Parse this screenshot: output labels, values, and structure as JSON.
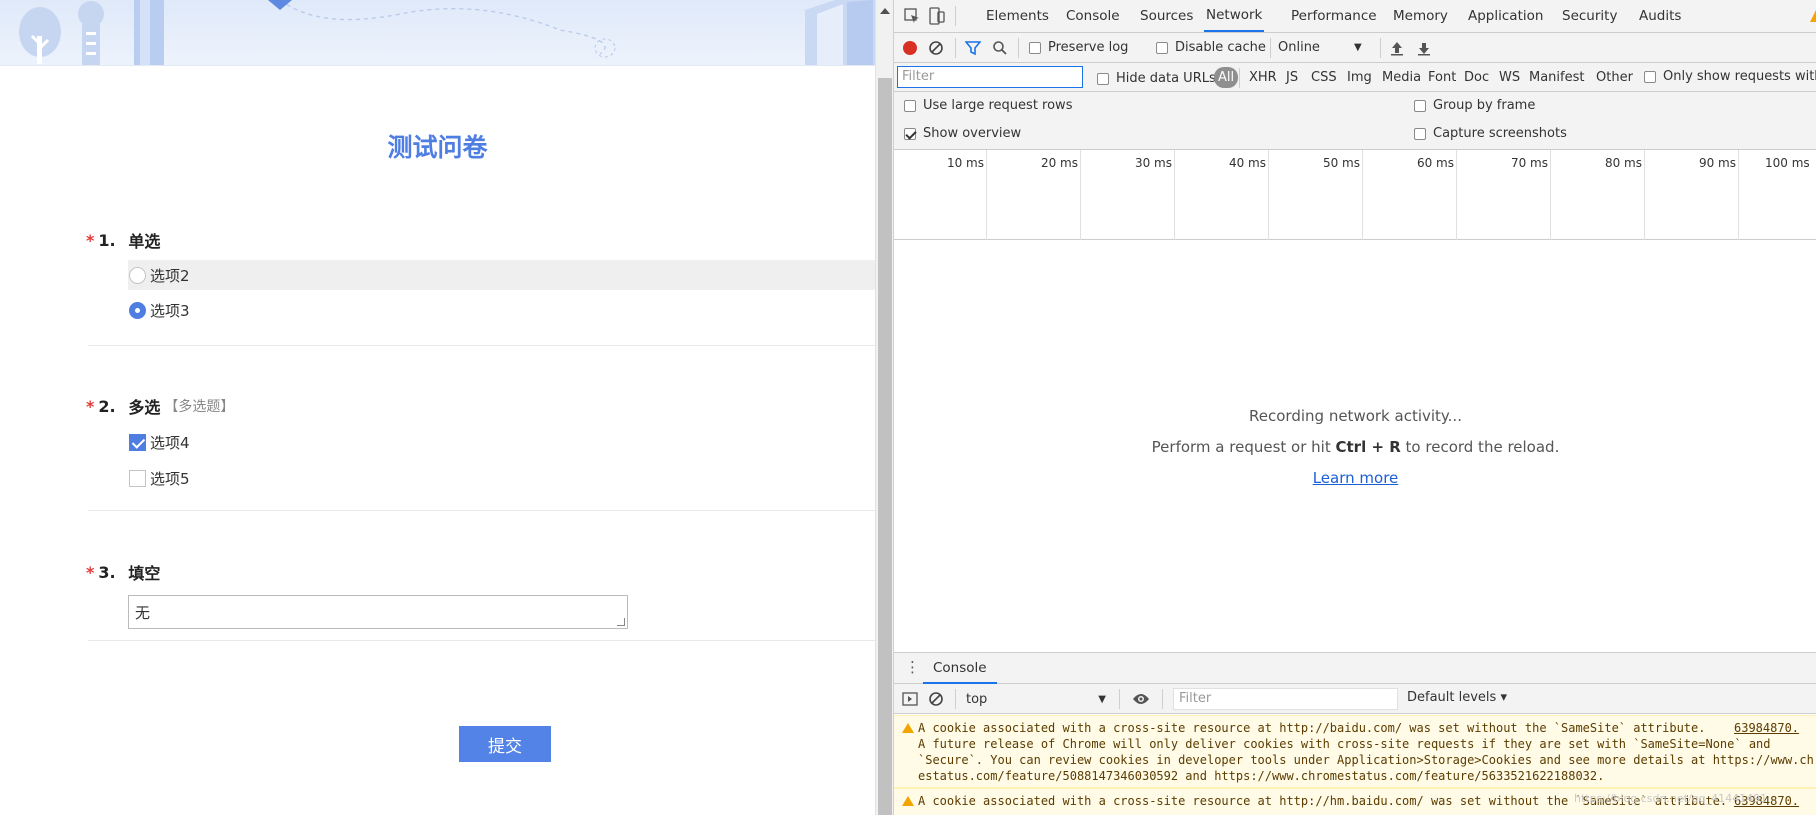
{
  "survey": {
    "title": "测试问卷",
    "questions": [
      {
        "star": "*",
        "number": "1.",
        "label": "单选",
        "options": [
          {
            "label": "选项2",
            "selected": false
          },
          {
            "label": "选项3",
            "selected": true
          }
        ]
      },
      {
        "star": "*",
        "number": "2.",
        "label": "多选",
        "type_tag": "【多选题】",
        "options": [
          {
            "label": "选项4",
            "checked": true
          },
          {
            "label": "选项5",
            "checked": false
          }
        ]
      },
      {
        "star": "*",
        "number": "3.",
        "label": "填空",
        "value": "无"
      }
    ],
    "submit_label": "提交",
    "accent_color": "#4f7ee3"
  },
  "devtools": {
    "tabs": [
      "Elements",
      "Console",
      "Sources",
      "Network",
      "Performance",
      "Memory",
      "Application",
      "Security",
      "Audits"
    ],
    "active_tab": "Network",
    "toolbar": {
      "preserve_log": "Preserve log",
      "disable_cache": "Disable cache",
      "throttle": "Online"
    },
    "filter": {
      "placeholder": "Filter",
      "hide_data_urls": "Hide data URLs",
      "types": [
        "All",
        "XHR",
        "JS",
        "CSS",
        "Img",
        "Media",
        "Font",
        "Doc",
        "WS",
        "Manifest",
        "Other"
      ],
      "only_show": "Only show requests with SameSite issues"
    },
    "settings": {
      "large_rows": "Use large request rows",
      "show_overview": "Show overview",
      "group_by_frame": "Group by frame",
      "capture_screenshots": "Capture screenshots"
    },
    "timeline_labels": [
      "10 ms",
      "20 ms",
      "30 ms",
      "40 ms",
      "50 ms",
      "60 ms",
      "70 ms",
      "80 ms",
      "90 ms",
      "100 ms"
    ],
    "empty": {
      "line1": "Recording network activity...",
      "line2_pre": "Perform a request or hit ",
      "line2_key": "Ctrl + R",
      "line2_post": " to record the reload.",
      "learn_more": "Learn more"
    },
    "console": {
      "tab": "Console",
      "context": "top",
      "filter_placeholder": "Filter",
      "levels": "Default levels ▾",
      "messages": [
        {
          "lines": [
            "A cookie associated with a cross-site resource at http://baidu.com/ was set without the `SameSite` attribute.",
            "A future release of Chrome will only deliver cookies with cross-site requests if they are set with `SameSite=None` and",
            "`Secure`. You can review cookies in developer tools under Application>Storage>Cookies and see more details at https://www.chrom",
            "estatus.com/feature/5088147346030592 and https://www.chromestatus.com/feature/5633521622188032."
          ],
          "source": "63984870."
        },
        {
          "lines": [
            "A cookie associated with a cross-site resource at http://hm.baidu.com/ was set without the `SameSite` attribute."
          ],
          "source": "63984870."
        }
      ]
    },
    "watermark": "https://blog.csdn.net/qq_41441491"
  }
}
